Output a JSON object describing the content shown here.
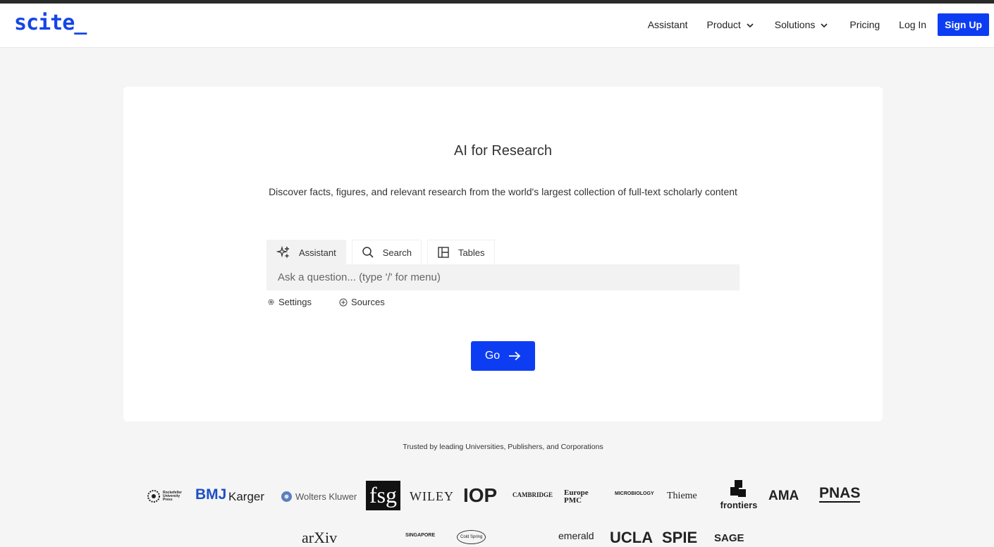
{
  "brand": {
    "logo": "scite_",
    "accent": "#0d3df2"
  },
  "nav": {
    "assistant": "Assistant",
    "product": "Product",
    "solutions": "Solutions",
    "pricing": "Pricing",
    "login": "Log In",
    "signup": "Sign Up"
  },
  "hero": {
    "title": "AI for Research",
    "subtitle": "Discover facts, figures, and relevant research from the world's largest collection of full-text scholarly content"
  },
  "tabs": [
    {
      "label": "Assistant",
      "icon": "sparkle-icon",
      "active": true
    },
    {
      "label": "Search",
      "icon": "search-icon",
      "active": false
    },
    {
      "label": "Tables",
      "icon": "table-icon",
      "active": false
    }
  ],
  "ask": {
    "placeholder": "Ask a question... (type '/' for menu)",
    "value": ""
  },
  "options": {
    "settings": "Settings",
    "sources": "Sources"
  },
  "go": {
    "label": "Go"
  },
  "trusted": {
    "text": "Trusted by leading Universities, Publishers, and Corporations",
    "row1": {
      "rockefeller": "Rockefeller University Press",
      "bmj": "BMJ",
      "karger": "Karger",
      "wolters": "Wolters Kluwer",
      "fsg": "fsg",
      "wiley": "WILEY",
      "iop": "IOP",
      "cambridge": "CAMBRIDGE",
      "europepmc": "Europe PMC",
      "microbiology": "MICROBIOLOGY",
      "thieme": "Thieme",
      "frontiers": "frontiers",
      "ama": "AMA",
      "pnas": "PNAS"
    },
    "row2": {
      "arxiv": "arXiv",
      "singapore": "SINGAPORE",
      "coldspring": "Cold Spring",
      "emerald": "emerald",
      "ucla": "UCLA",
      "spie": "SPIE",
      "sage": "SAGE"
    }
  }
}
